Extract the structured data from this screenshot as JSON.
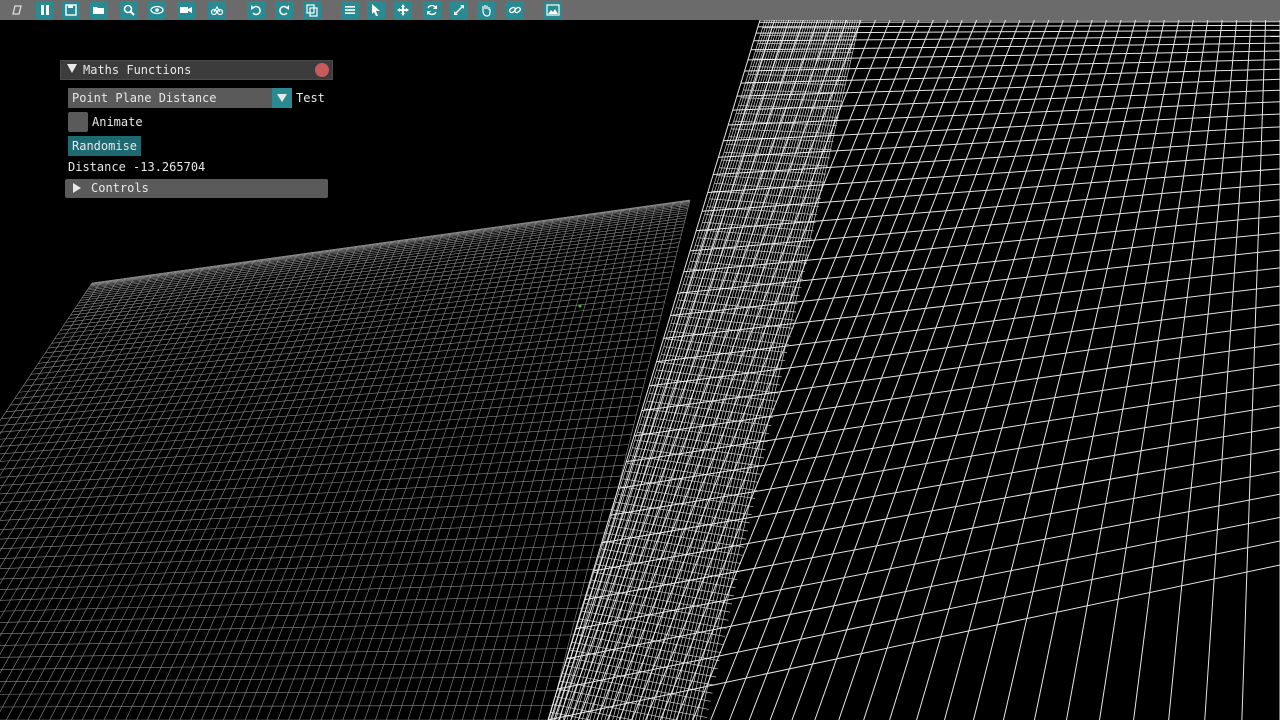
{
  "toolbar": {
    "buttons": [
      "new-shape-icon",
      "pause-icon",
      "save-icon",
      "open-folder-icon",
      "search-icon",
      "eye-icon",
      "video-camera-icon",
      "bicycle-icon",
      "undo-icon",
      "redo-icon",
      "copy-icon",
      "list-icon",
      "select-pointer-icon",
      "move-icon",
      "refresh-icon",
      "expand-icon",
      "hand-icon",
      "link-icon",
      "image-icon"
    ]
  },
  "window": {
    "title": "Maths Functions",
    "combo": {
      "value": "Point Plane Distance",
      "side_label": "Test"
    },
    "animate": {
      "label": "Animate",
      "checked": false
    },
    "randomise_label": "Randomise",
    "distance_text": "Distance -13.265704",
    "controls_label": "Controls"
  },
  "colors": {
    "background": "#000000",
    "toolbar": "#6b6b6b",
    "accent": "#2a8a92",
    "panel": "#3c3c3c",
    "control": "#5a5a5a",
    "close": "#c65b5b",
    "grid_line": "#ffffff"
  }
}
